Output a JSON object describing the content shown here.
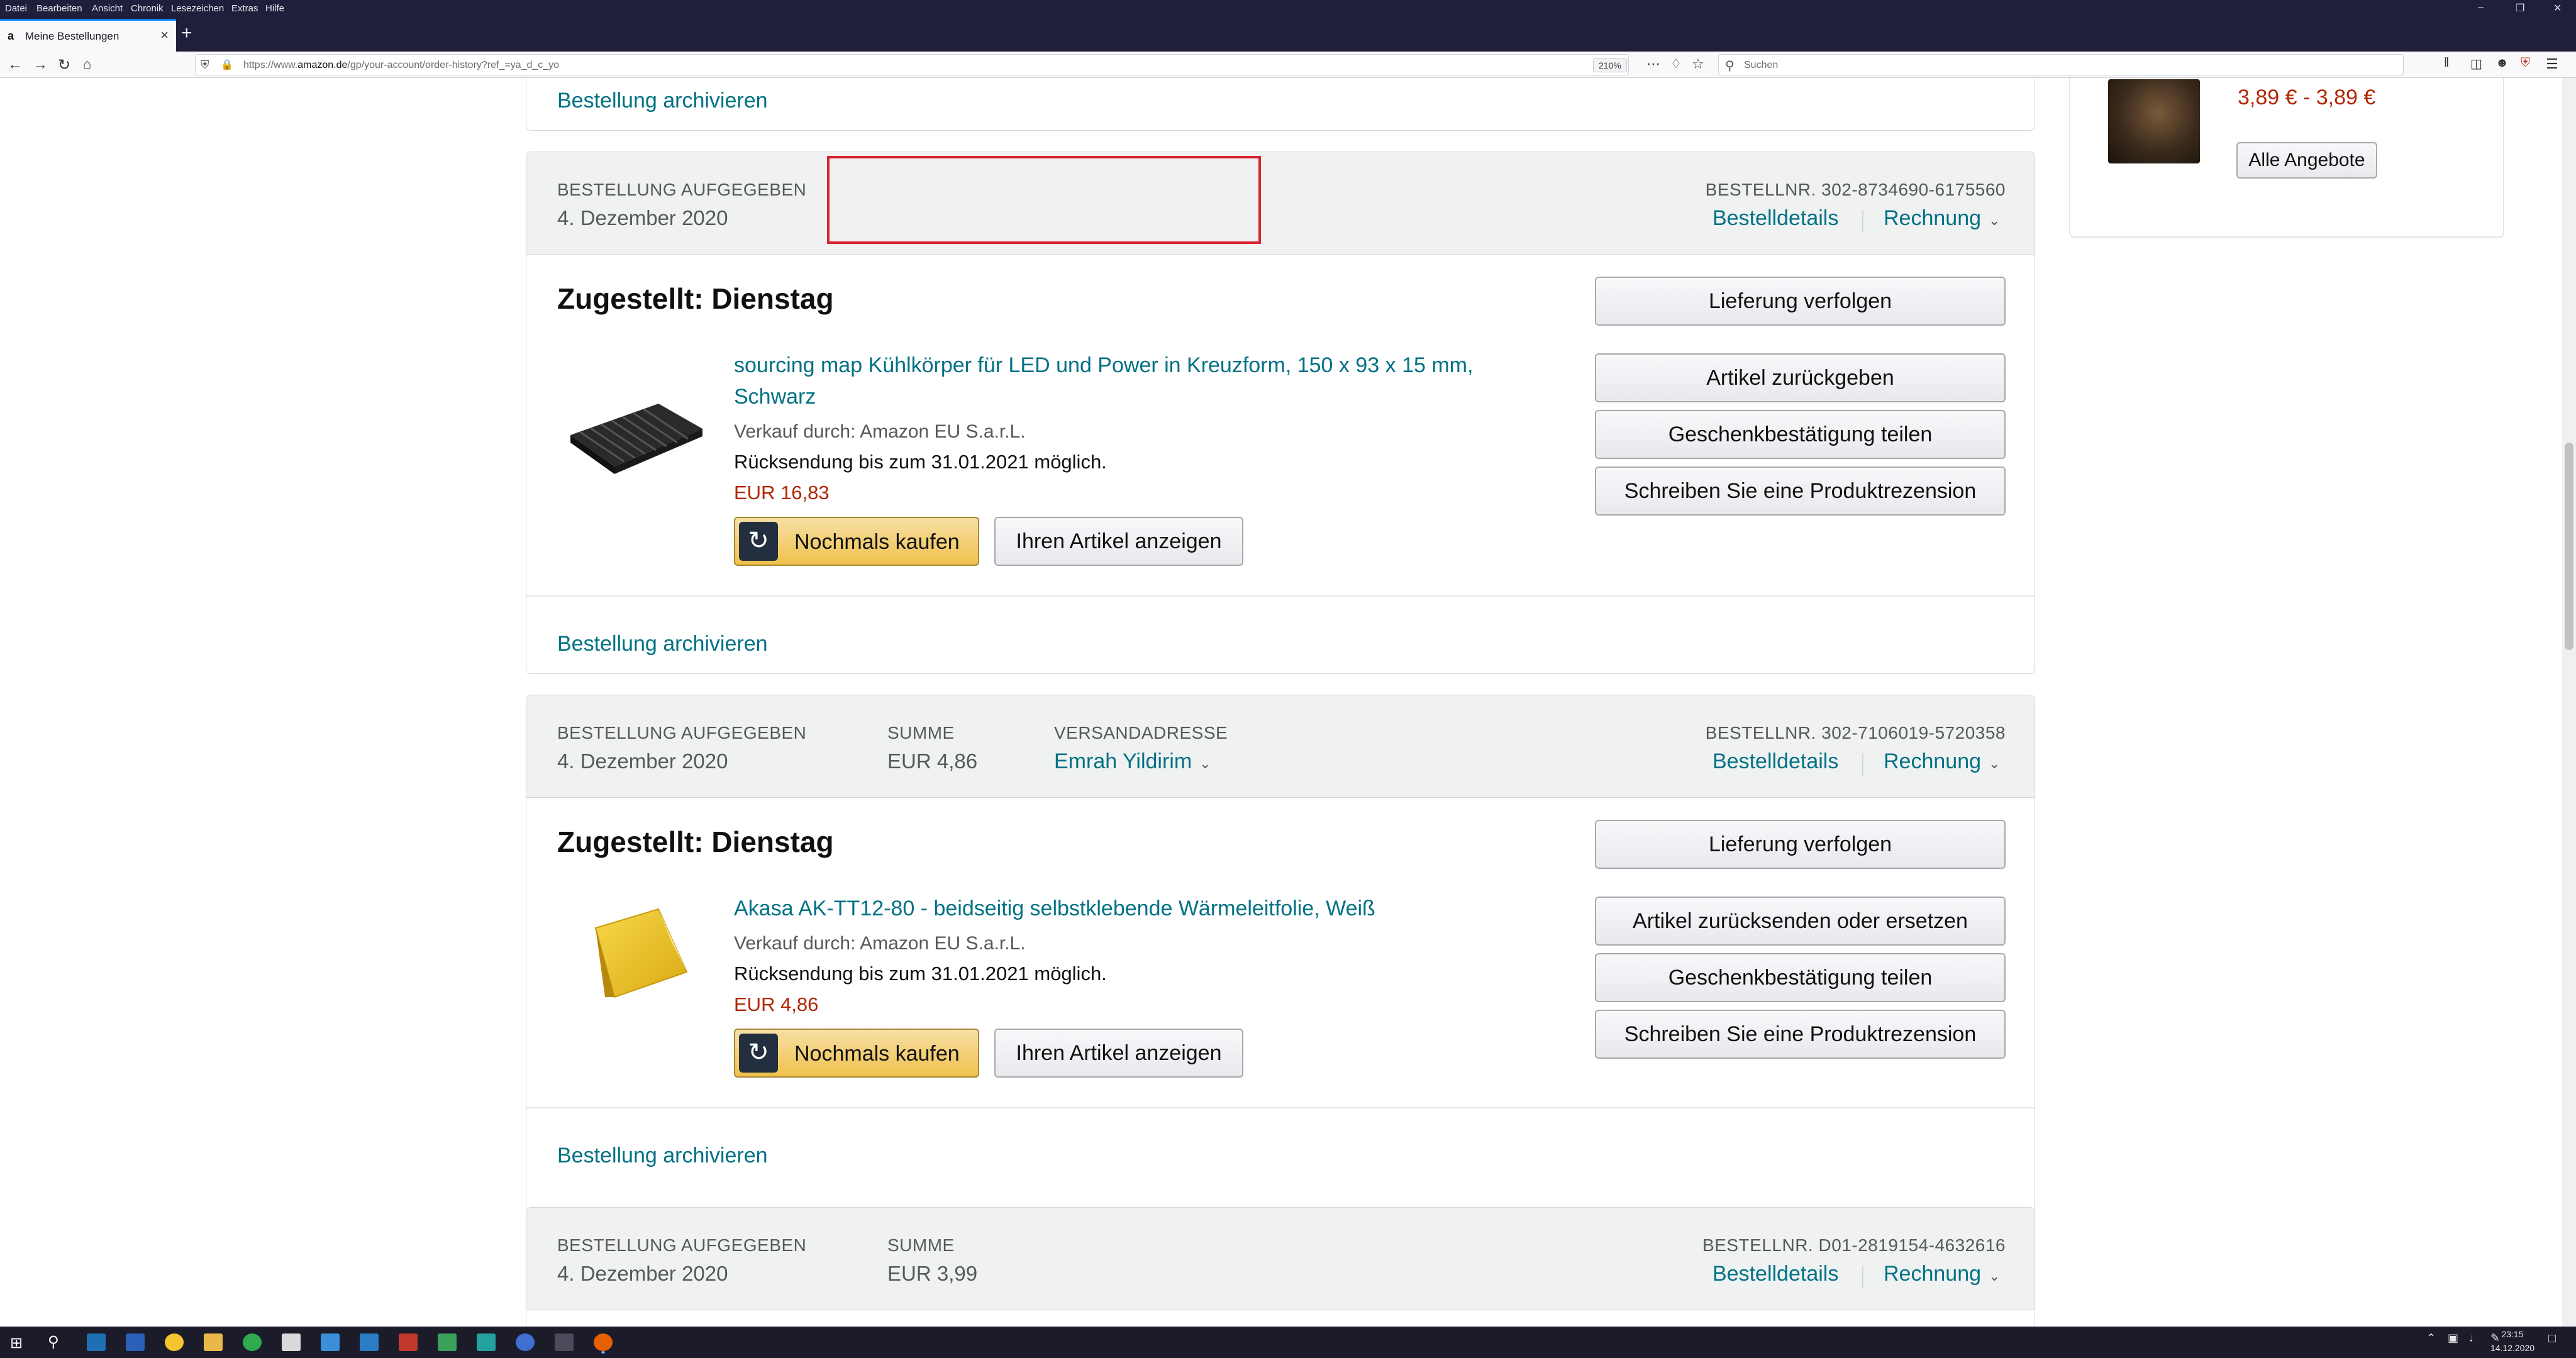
{
  "menubar": {
    "items": [
      "Datei",
      "Bearbeiten",
      "Ansicht",
      "Chronik",
      "Lesezeichen",
      "Extras",
      "Hilfe"
    ]
  },
  "browser": {
    "tab_title": "Meine Bestellungen",
    "url_prefix": "https://www.",
    "url_domain": "amazon.de",
    "url_rest": "/gp/your-account/order-history?ref_=ya_d_c_yo",
    "zoom": "210%",
    "search_placeholder": "Suchen"
  },
  "sidebar_offer": {
    "price_range": "3,89 € - 3,89 €",
    "all_offers_label": "Alle Angebote"
  },
  "top_archive_link": "Bestellung archivieren",
  "orders": [
    {
      "placed_label": "BESTELLUNG AUFGEGEBEN",
      "placed_date": "4. Dezember 2020",
      "order_no": "BESTELLNR. 302-8734690-6175560",
      "details_label": "Bestelldetails",
      "invoice_label": "Rechnung",
      "status": "Zugestellt: Dienstag",
      "product_title": "sourcing map Kühlkörper für LED und Power in Kreuzform, 150 x 93 x 15 mm, Schwarz",
      "seller": "Verkauf durch: Amazon EU S.a.r.L.",
      "return_info": "Rücksendung bis zum 31.01.2021 möglich.",
      "price": "EUR 16,83",
      "buy_again_label": "Nochmals kaufen",
      "view_item_label": "Ihren Artikel anzeigen",
      "actions": [
        "Lieferung verfolgen",
        "Artikel zurückgeben",
        "Geschenkbestätigung teilen",
        "Schreiben Sie eine Produktrezension"
      ],
      "archive_label": "Bestellung archivieren"
    },
    {
      "placed_label": "BESTELLUNG AUFGEGEBEN",
      "placed_date": "4. Dezember 2020",
      "sum_label": "SUMME",
      "sum_value": "EUR 4,86",
      "ship_label": "VERSANDADRESSE",
      "ship_name": "Emrah Yildirim",
      "order_no": "BESTELLNR. 302-7106019-5720358",
      "details_label": "Bestelldetails",
      "invoice_label": "Rechnung",
      "status": "Zugestellt: Dienstag",
      "product_title": "Akasa AK-TT12-80 - beidseitig selbstklebende Wärmeleitfolie, Weiß",
      "seller": "Verkauf durch: Amazon EU S.a.r.L.",
      "return_info": "Rücksendung bis zum 31.01.2021 möglich.",
      "price": "EUR 4,86",
      "buy_again_label": "Nochmals kaufen",
      "view_item_label": "Ihren Artikel anzeigen",
      "actions": [
        "Lieferung verfolgen",
        "Artikel zurücksenden oder ersetzen",
        "Geschenkbestätigung teilen",
        "Schreiben Sie eine Produktrezension"
      ],
      "archive_label": "Bestellung archivieren"
    },
    {
      "placed_label": "BESTELLUNG AUFGEGEBEN",
      "placed_date": "4. Dezember 2020",
      "sum_label": "SUMME",
      "sum_value": "EUR 3,99",
      "order_no": "BESTELLNR. D01-2819154-4632616",
      "details_label": "Bestelldetails",
      "invoice_label": "Rechnung"
    }
  ],
  "taskbar": {
    "time": "23:15",
    "date": "14.12.2020"
  },
  "colors": {
    "link": "#007185",
    "price": "#b12704",
    "buy_button": "#f0c14b",
    "header_bg": "#f0f2f2",
    "redaction_border": "#d9232e"
  }
}
